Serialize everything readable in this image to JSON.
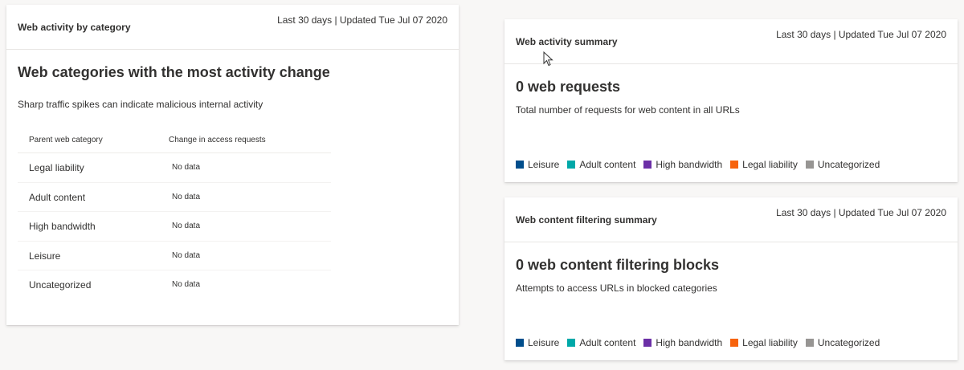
{
  "colors": {
    "leisure": "#004e8c",
    "adult_content": "#00a8a8",
    "high_bandwidth": "#6b2fa6",
    "legal_liability": "#f7630c",
    "uncategorized": "#979593"
  },
  "activity_by_category": {
    "title": "Web activity by category",
    "meta": "Last 30 days | Updated Tue Jul 07 2020",
    "heading": "Web categories with the most activity change",
    "subtext": "Sharp traffic spikes can indicate malicious internal activity",
    "columns": [
      "Parent web category",
      "Change in access requests"
    ],
    "rows": [
      {
        "category": "Legal liability",
        "change": "No data"
      },
      {
        "category": "Adult content",
        "change": "No data"
      },
      {
        "category": "High bandwidth",
        "change": "No data"
      },
      {
        "category": "Leisure",
        "change": "No data"
      },
      {
        "category": "Uncategorized",
        "change": "No data"
      }
    ]
  },
  "activity_summary": {
    "title": "Web activity summary",
    "meta": "Last 30 days | Updated Tue Jul 07 2020",
    "heading": "0 web requests",
    "subtext": "Total number of requests for web content in all URLs",
    "legend": [
      "Leisure",
      "Adult content",
      "High bandwidth",
      "Legal liability",
      "Uncategorized"
    ]
  },
  "filtering_summary": {
    "title": "Web content filtering summary",
    "meta": "Last 30 days | Updated Tue Jul 07 2020",
    "heading": "0 web content filtering blocks",
    "subtext": "Attempts to access URLs in blocked categories",
    "legend": [
      "Leisure",
      "Adult content",
      "High bandwidth",
      "Legal liability",
      "Uncategorized"
    ]
  }
}
